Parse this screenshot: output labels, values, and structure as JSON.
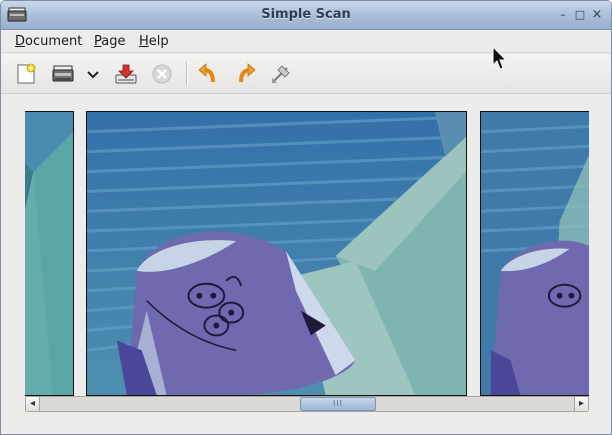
{
  "window": {
    "title": "Simple Scan",
    "controls": {
      "minimize": "–",
      "maximize": "□",
      "close": "×"
    }
  },
  "menubar": {
    "items": [
      {
        "label_mnemonic": "D",
        "label_rest": "ocument"
      },
      {
        "label_mnemonic": "P",
        "label_rest": "age"
      },
      {
        "label_mnemonic": "H",
        "label_rest": "elp"
      }
    ]
  },
  "toolbar": {
    "icons": [
      "new-document-icon",
      "scan-icon",
      "scan-options-dropdown-icon",
      "save-icon",
      "stop-icon",
      "rotate-left-icon",
      "rotate-right-icon",
      "crop-icon"
    ]
  },
  "scrollbar": {
    "left_arrow": "◂",
    "right_arrow": "▸",
    "grip": "III",
    "position_fraction": 0.5
  },
  "pages": [
    {
      "name": "page-previous"
    },
    {
      "name": "page-current"
    },
    {
      "name": "page-next"
    }
  ],
  "colors": {
    "titlebar": "#a9bdd8",
    "background": "#edeceb",
    "accent_orange": "#f0a030",
    "save_red": "#d03030"
  }
}
